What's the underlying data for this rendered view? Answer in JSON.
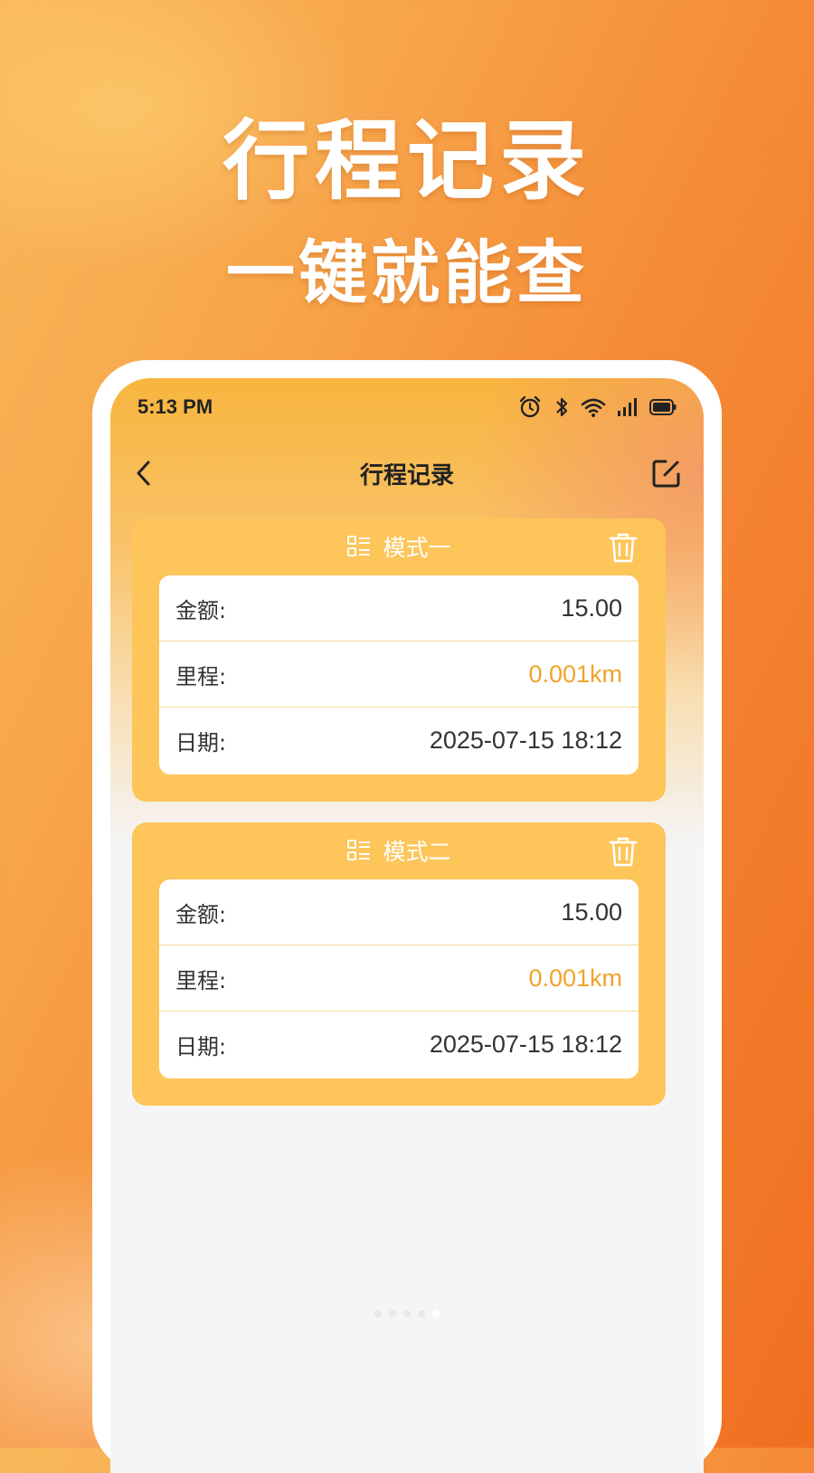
{
  "headline": {
    "line1": "行程记录",
    "line2": "一键就能查"
  },
  "status_bar": {
    "time": "5:13 PM"
  },
  "nav": {
    "title": "行程记录"
  },
  "records": [
    {
      "mode": "模式一",
      "rows": [
        {
          "label": "金额:",
          "value": "15.00"
        },
        {
          "label": "里程:",
          "value": "0.001km"
        },
        {
          "label": "日期:",
          "value": "2025-07-15 18:12"
        }
      ]
    },
    {
      "mode": "模式二",
      "rows": [
        {
          "label": "金额:",
          "value": "15.00"
        },
        {
          "label": "里程:",
          "value": "0.001km"
        },
        {
          "label": "日期:",
          "value": "2025-07-15 18:12"
        }
      ]
    }
  ],
  "colors": {
    "card": "#fdc55a",
    "accent_value": "#f0a22c",
    "background_orange": "#f58a36"
  },
  "icons": [
    "alarm-icon",
    "bluetooth-icon",
    "wifi-icon",
    "signal-icon",
    "battery-icon",
    "back-arrow-icon",
    "edit-icon",
    "list-mode-icon",
    "trash-icon"
  ]
}
